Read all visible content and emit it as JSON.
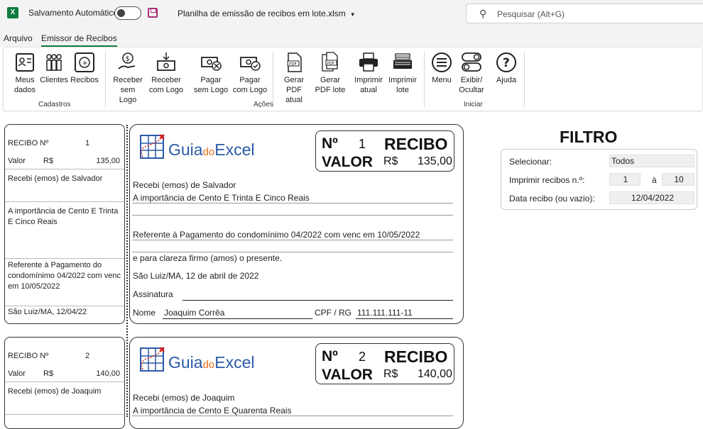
{
  "titlebar": {
    "app_icon": "excel-icon",
    "autosave_label": "Salvamento Automático",
    "autosave_state": "off",
    "filename": "Planilha de emissão de recibos em lote.xlsm",
    "search_placeholder": "Pesquisar (Alt+G)"
  },
  "menu": {
    "tabs": [
      "Arquivo",
      "Emissor de Recibos"
    ],
    "active_tab": "Emissor de Recibos"
  },
  "ribbon": {
    "groups": [
      {
        "label": "Cadastros",
        "buttons": [
          {
            "line1": "Meus",
            "line2": "dados",
            "icon": "contact-card-icon"
          },
          {
            "line1": "Clientes",
            "line2": "",
            "icon": "people-group-icon"
          },
          {
            "line1": "Recibos",
            "line2": "",
            "icon": "receipt-box-icon"
          }
        ]
      },
      {
        "label": "Ações",
        "buttons": [
          {
            "line1": "Receber",
            "line2": "sem Logo",
            "icon": "money-hand-icon"
          },
          {
            "line1": "Receber",
            "line2": "com Logo",
            "icon": "money-down-icon"
          },
          {
            "line1": "Pagar",
            "line2": "sem Logo",
            "icon": "pay-cancel-icon"
          },
          {
            "line1": "Pagar",
            "line2": "com Logo",
            "icon": "pay-check-icon"
          },
          {
            "line1": "Gerar",
            "line2": "PDF atual",
            "icon": "pdf-file-icon"
          },
          {
            "line1": "Gerar",
            "line2": "PDF lote",
            "icon": "pdf-stack-icon"
          },
          {
            "line1": "Imprimir",
            "line2": "atual",
            "icon": "printer-icon"
          },
          {
            "line1": "Imprimir",
            "line2": "lote",
            "icon": "print-stack-icon"
          }
        ]
      },
      {
        "label": "Iniciar",
        "buttons": [
          {
            "line1": "Menu",
            "line2": "",
            "icon": "menu-circle-icon"
          },
          {
            "line1": "Exibir/",
            "line2": "Ocultar",
            "icon": "toggle-switch-icon"
          },
          {
            "line1": "Ajuda",
            "line2": "",
            "icon": "help-circle-icon"
          }
        ]
      }
    ]
  },
  "filter": {
    "title": "FILTRO",
    "select_label": "Selecionar:",
    "select_value": "Todos",
    "range_label": "Imprimir recibos n.º:",
    "range_from": "1",
    "range_sep": "à",
    "range_to": "10",
    "date_label": "Data recibo (ou vazio):",
    "date_value": "12/04/2022"
  },
  "receipts": [
    {
      "stub": {
        "label": "RECIBO Nº",
        "number": "1",
        "value_label": "Valor",
        "currency": "R$",
        "amount": "135,00",
        "received_from": "Recebi (emos) de Salvador",
        "amount_words": "A importância de Cento E Trinta E Cinco Reais",
        "reference": "Referente à Pagamento do condomínimo 04/2022 com venc em 10/05/2022",
        "place_date": "São Luiz/MA, 12/04/22"
      },
      "main": {
        "logo_text_a": "Guia",
        "logo_text_b": "do",
        "logo_text_c": "Excel",
        "no_label": "Nº",
        "number": "1",
        "title": "RECIBO",
        "value_label": "VALOR",
        "currency": "R$",
        "amount": "135,00",
        "received_from": "Recebi (emos) de Salvador",
        "amount_words": "A importância de Cento E Trinta E Cinco Reais",
        "reference": "Referente à Pagamento do condomínimo 04/2022 com venc em 10/05/2022",
        "clarity": "e para clareza firmo (amos) o presente.",
        "place_date": "São Luiz/MA, 12 de abril de 2022",
        "signature_label": "Assinatura",
        "name_label": "Nome",
        "name": "Joaquim Corrêa",
        "cpf_label": "CPF / RG",
        "cpf": "111.111.111-11"
      }
    },
    {
      "stub": {
        "label": "RECIBO Nº",
        "number": "2",
        "value_label": "Valor",
        "currency": "R$",
        "amount": "140,00",
        "received_from": "Recebi (emos) de Joaquim"
      },
      "main": {
        "logo_text_a": "Guia",
        "logo_text_b": "do",
        "logo_text_c": "Excel",
        "no_label": "Nº",
        "number": "2",
        "title": "RECIBO",
        "value_label": "VALOR",
        "currency": "R$",
        "amount": "140,00",
        "received_from": "Recebi (emos) de Joaquim",
        "amount_words": "A importância de Cento E Quarenta Reais"
      }
    }
  ]
}
